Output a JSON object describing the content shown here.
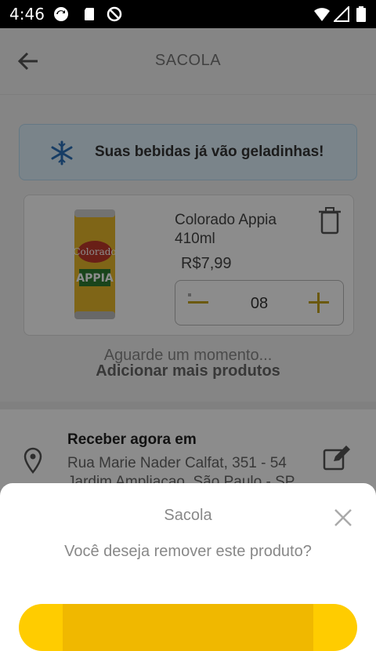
{
  "status_bar": {
    "time": "4:46",
    "left_icons": [
      "sync-icon",
      "sd-card-icon",
      "do-not-disturb-icon"
    ],
    "right_icons": [
      "wifi-icon",
      "cell-signal-icon",
      "battery-icon"
    ]
  },
  "header": {
    "title": "SACOLA",
    "back_icon": "arrow-left-icon"
  },
  "banner": {
    "icon": "snowflake-icon",
    "text": "Suas bebidas já vão geladinhas!",
    "color": "#dff0fb"
  },
  "cart_item": {
    "name_line1": "Colorado Appia",
    "name_line2": "410ml",
    "price": "R$7,99",
    "quantity": "08"
  },
  "loading_text": "Aguarde um momento...",
  "add_more_label": "Adicionar mais produtos",
  "delivery": {
    "label": "Receber agora em",
    "address_line1": "Rua Marie Nader Calfat, 351 - 54",
    "address_line2": "Jardim Ampliacao, São Paulo - SP"
  },
  "dialog": {
    "title": "Sacola",
    "question": "Você deseja remover este produto?",
    "confirm_color": "#ffcc00"
  }
}
